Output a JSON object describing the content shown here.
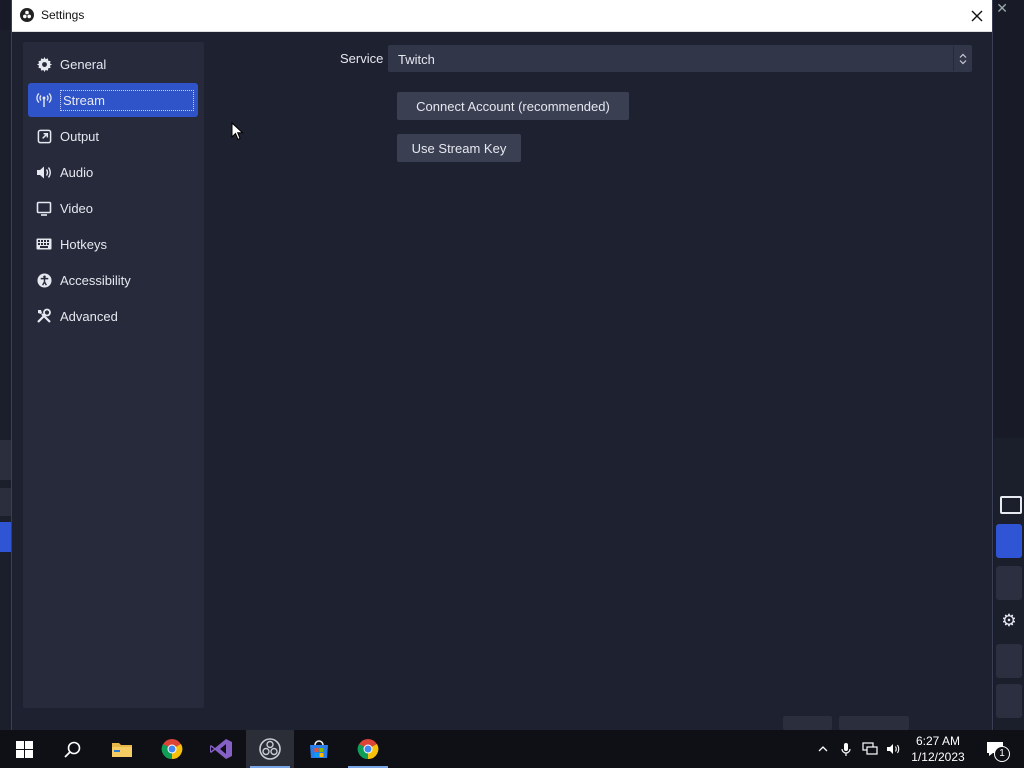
{
  "window": {
    "title": "Settings"
  },
  "sidebar": {
    "items": [
      {
        "label": "General",
        "icon": "gear-icon"
      },
      {
        "label": "Stream",
        "icon": "broadcast-icon"
      },
      {
        "label": "Output",
        "icon": "output-icon"
      },
      {
        "label": "Audio",
        "icon": "speaker-icon"
      },
      {
        "label": "Video",
        "icon": "monitor-icon"
      },
      {
        "label": "Hotkeys",
        "icon": "keyboard-icon"
      },
      {
        "label": "Accessibility",
        "icon": "accessibility-icon"
      },
      {
        "label": "Advanced",
        "icon": "tools-icon"
      }
    ],
    "active": "Stream"
  },
  "stream": {
    "service_label": "Service",
    "service_value": "Twitch",
    "connect_button": "Connect Account (recommended)",
    "stream_key_button": "Use Stream Key"
  },
  "taskbar": {
    "time": "6:27 AM",
    "date": "1/12/2023",
    "notification_count": "1"
  },
  "colors": {
    "accent": "#2f54c9",
    "window_bg": "#1e2130",
    "sidebar_bg": "#262a3b"
  }
}
